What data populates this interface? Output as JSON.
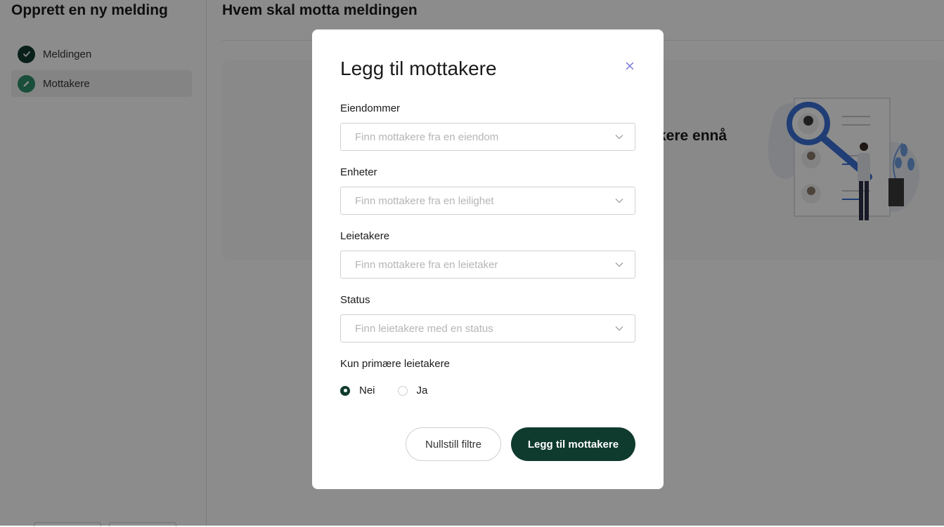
{
  "sidebar": {
    "title": "Opprett en ny melding",
    "steps": [
      {
        "label": "Meldingen",
        "status": "done"
      },
      {
        "label": "Mottakere",
        "status": "active"
      }
    ]
  },
  "main": {
    "title": "Hvem skal motta meldingen",
    "empty_text": "kere ennå"
  },
  "modal": {
    "title": "Legg til mottakere",
    "fields": [
      {
        "label": "Eiendommer",
        "placeholder": "Finn mottakere fra en eiendom"
      },
      {
        "label": "Enheter",
        "placeholder": "Finn mottakere fra en leilighet"
      },
      {
        "label": "Leietakere",
        "placeholder": "Finn mottakere fra en leietaker"
      },
      {
        "label": "Status",
        "placeholder": "Finn leietakere med en status"
      }
    ],
    "primary_only": {
      "label": "Kun primære leietakere",
      "options": [
        {
          "label": "Nei",
          "selected": true
        },
        {
          "label": "Ja",
          "selected": false
        }
      ]
    },
    "reset_button": "Nullstill filtre",
    "submit_button": "Legg til mottakere"
  },
  "colors": {
    "primary": "#0f3b2e",
    "step_done": "#0f3b2e",
    "step_active": "#2f8f6b",
    "accent_blue": "#3b6fd6"
  }
}
